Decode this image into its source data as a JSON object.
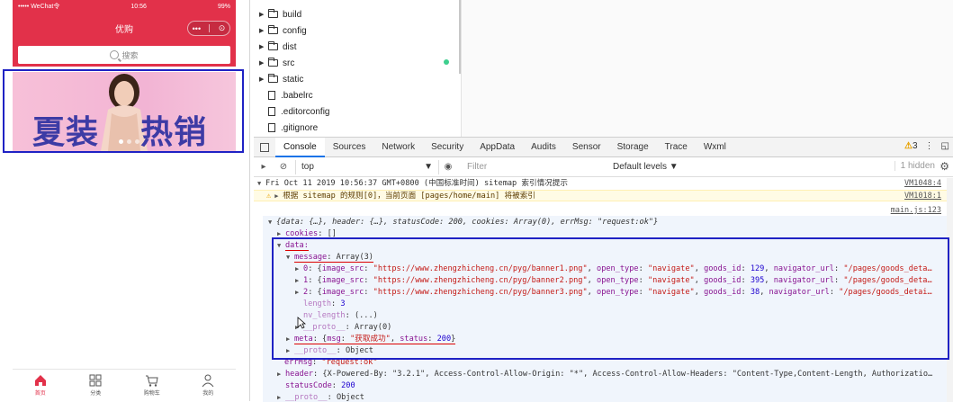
{
  "phone": {
    "status": {
      "carrier": "••••• WeChat令",
      "time": "10:56",
      "battery": "99%"
    },
    "nav_title": "优购",
    "capsule": {
      "more": "•••",
      "close": "⊙"
    },
    "search_placeholder": "搜索",
    "banner": {
      "left_text": "夏装",
      "right_text": "热销榜"
    },
    "tabs": [
      {
        "label": "首页",
        "icon": "home-icon"
      },
      {
        "label": "分类",
        "icon": "category-icon"
      },
      {
        "label": "购物车",
        "icon": "cart-icon"
      },
      {
        "label": "我的",
        "icon": "user-icon"
      }
    ],
    "colors": {
      "brand": "#e2314a",
      "banner_text": "#3d3ba5"
    }
  },
  "filetree": {
    "items": [
      {
        "name": "build",
        "type": "folder"
      },
      {
        "name": "config",
        "type": "folder"
      },
      {
        "name": "dist",
        "type": "folder"
      },
      {
        "name": "src",
        "type": "folder"
      },
      {
        "name": "static",
        "type": "folder"
      },
      {
        "name": ".babelrc",
        "type": "file"
      },
      {
        "name": ".editorconfig",
        "type": "file"
      },
      {
        "name": ".gitignore",
        "type": "file"
      }
    ]
  },
  "devtools": {
    "tabs": [
      "Console",
      "Sources",
      "Network",
      "Security",
      "AppData",
      "Audits",
      "Sensor",
      "Storage",
      "Trace",
      "Wxml"
    ],
    "active_tab": "Console",
    "warnings_count": "3",
    "context": "top",
    "filter_placeholder": "Filter",
    "levels": "Default levels ▼",
    "hidden": "1 hidden",
    "console": {
      "header_text": "Fri Oct 11 2019 10:56:37 GMT+0800 (中国标准时间) sitemap 索引情况提示",
      "header_src": "VM1048:4",
      "warn_text": "根据 sitemap 的规则[0]，当前页面 [pages/home/main] 将被索引",
      "warn_src": "VM1018:1",
      "main_src": "main.js:123",
      "summary": "{data: {…}, header: {…}, statusCode: 200, cookies: Array(0), errMsg: \"request:ok\"}",
      "cookies_key": "cookies",
      "cookies_val": "[]",
      "data_key": "data:",
      "message_key": "message",
      "message_val": "Array(3)",
      "items": [
        {
          "index": "0",
          "image_src": "\"https://www.zhengzhicheng.cn/pyg/banner1.png\"",
          "open_type": "\"navigate\"",
          "goods_id": "129",
          "navigator_url": "\"/pages/goods_deta…"
        },
        {
          "index": "1",
          "image_src": "\"https://www.zhengzhicheng.cn/pyg/banner2.png\"",
          "open_type": "\"navigate\"",
          "goods_id": "395",
          "navigator_url": "\"/pages/goods_deta…"
        },
        {
          "index": "2",
          "image_src": "\"https://www.zhengzhicheng.cn/pyg/banner3.png\"",
          "open_type": "\"navigate\"",
          "goods_id": "38",
          "navigator_url": "\"/pages/goods_detai…"
        }
      ],
      "length_key": "length",
      "length_val": "3",
      "nv_length_key": "nv_length",
      "nv_length_val": "(...)",
      "proto_key": "__proto__",
      "proto_array": "Array(0)",
      "meta_key": "meta",
      "meta_msg": "\"获取成功\"",
      "meta_status": "200",
      "proto_object": "Object",
      "errmsg_key": "errMsg",
      "errmsg_val": "\"request:ok\"",
      "header_key": "header",
      "header_val": "{X-Powered-By: \"3.2.1\", Access-Control-Allow-Origin: \"*\", Access-Control-Allow-Headers: \"Content-Type,Content-Length, Authorizatio…",
      "status_key": "statusCode",
      "status_val": "200"
    }
  }
}
